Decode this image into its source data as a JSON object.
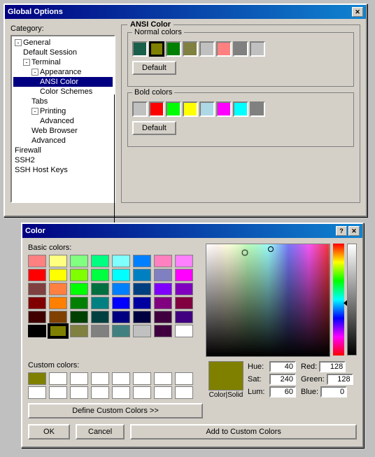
{
  "globalOptions": {
    "title": "Global Options",
    "categoryLabel": "Category:",
    "tree": [
      {
        "label": "General",
        "level": 0,
        "expand": "-"
      },
      {
        "label": "Default Session",
        "level": 1
      },
      {
        "label": "Terminal",
        "level": 0,
        "expand": "-"
      },
      {
        "label": "Appearance",
        "level": 1,
        "expand": "-"
      },
      {
        "label": "ANSI Color",
        "level": 2,
        "selected": true
      },
      {
        "label": "Color Schemes",
        "level": 2
      },
      {
        "label": "Tabs",
        "level": 1
      },
      {
        "label": "Printing",
        "level": 1,
        "expand": "-"
      },
      {
        "label": "Advanced",
        "level": 2
      },
      {
        "label": "Web Browser",
        "level": 1
      },
      {
        "label": "Advanced",
        "level": 1
      },
      {
        "label": "Firewall",
        "level": 0
      },
      {
        "label": "SSH2",
        "level": 0
      },
      {
        "label": "SSH Host Keys",
        "level": 0
      }
    ],
    "ansiPanel": {
      "title": "ANSI Color",
      "normalColorsLabel": "Normal colors",
      "boldColorsLabel": "Bold colors",
      "defaultBtn": "Default",
      "normalColors": [
        "#1a5f4a",
        "#808000",
        "#008000",
        "#808000",
        "#c0c0c0",
        "#ff8080",
        "#808080",
        "#c0c0c0"
      ],
      "boldColors": [
        "#c0c0c0",
        "#ff0000",
        "#00ff00",
        "#ffff00",
        "#add8e6",
        "#ff00ff",
        "#00ffff",
        "#808080"
      ]
    }
  },
  "colorDialog": {
    "title": "Color",
    "helpBtn": "?",
    "basicColorsLabel": "Basic colors:",
    "customColorsLabel": "Custom colors:",
    "defineCustomBtn": "Define Custom Colors >>",
    "okBtn": "OK",
    "cancelBtn": "Cancel",
    "addCustomBtn": "Add to Custom Colors",
    "colorSolidLabel": "Color|Solid",
    "hueLabel": "Hue:",
    "satLabel": "Sat:",
    "lumLabel": "Lum:",
    "redLabel": "Red:",
    "greenLabel": "Green:",
    "blueLabel": "Blue:",
    "hueValue": "40",
    "satValue": "240",
    "lumValue": "60",
    "redValue": "128",
    "greenValue": "128",
    "blueValue": "0",
    "basicColors": [
      "#ff8080",
      "#ffff80",
      "#80ff80",
      "#00ff80",
      "#80ffff",
      "#0080ff",
      "#ff80c0",
      "#ff80ff",
      "#ff0000",
      "#ffff00",
      "#80ff00",
      "#00ff40",
      "#00ffff",
      "#0080c0",
      "#8080c0",
      "#ff00ff",
      "#804040",
      "#ff8040",
      "#00ff00",
      "#007040",
      "#0080ff",
      "#004080",
      "#8000ff",
      "#8000c0",
      "#800000",
      "#ff8000",
      "#008000",
      "#008080",
      "#0000ff",
      "#0000a0",
      "#800080",
      "#800040",
      "#400000",
      "#804000",
      "#004000",
      "#004040",
      "#000080",
      "#000040",
      "#400040",
      "#400080",
      "#000000",
      "#808000",
      "#808040",
      "#808080",
      "#408080",
      "#c0c0c0",
      "#400040",
      "#ffffff"
    ],
    "customColors": [
      "#808000",
      "#ffffff",
      "#ffffff",
      "#ffffff",
      "#ffffff",
      "#ffffff",
      "#ffffff",
      "#ffffff",
      "#ffffff",
      "#ffffff",
      "#ffffff",
      "#ffffff",
      "#ffffff",
      "#ffffff",
      "#ffffff",
      "#ffffff"
    ]
  }
}
